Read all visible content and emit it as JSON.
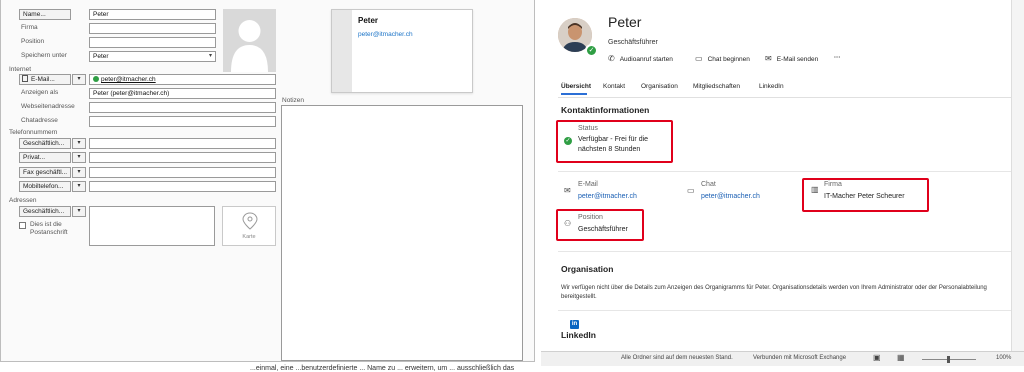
{
  "form": {
    "name_btn": "Name...",
    "name_val": "Peter",
    "firma_lbl": "Firma",
    "position_lbl": "Position",
    "speichern_lbl": "Speichern unter",
    "speichern_val": "Peter",
    "internet_lbl": "Internet",
    "email_btn": "E-Mail...",
    "email_val": "peter@itmacher.ch",
    "anzeigen_lbl": "Anzeigen als",
    "anzeigen_val": "Peter (peter@itmacher.ch)",
    "webseite_lbl": "Webseitenadresse",
    "chat_lbl": "Chatadresse",
    "telefon_lbl": "Telefonnummern",
    "phones": [
      "Geschäftlich...",
      "Privat...",
      "Fax geschäftl...",
      "Mobiltelefon..."
    ],
    "adressen_lbl": "Adressen",
    "adr_btn": "Geschäftlich...",
    "postanschrift": "Dies ist die Postanschrift",
    "notizen_lbl": "Notizen",
    "karte": "Karte",
    "card_name": "Peter",
    "card_email": "peter@itmacher.ch"
  },
  "profile": {
    "name": "Peter",
    "title": "Geschäftsführer",
    "actions": [
      "Audioanruf starten",
      "Chat beginnen",
      "E-Mail senden",
      "···"
    ],
    "tabs": [
      "Übersicht",
      "Kontakt",
      "Organisation",
      "Mitgliedschaften",
      "LinkedIn"
    ],
    "kontakt_heading": "Kontaktinformationen",
    "status_label": "Status",
    "status_line1": "Verfügbar - Frei für die",
    "status_line2": "nächsten 8 Stunden",
    "email_label": "E-Mail",
    "email_value": "peter@itmacher.ch",
    "chat_label": "Chat",
    "chat_value": "peter@itmacher.ch",
    "firma_label": "Firma",
    "firma_value": "IT-Macher Peter Scheurer",
    "position_label": "Position",
    "position_value": "Geschäftsführer",
    "org_heading": "Organisation",
    "org_text": "Wir verfügen nicht über die Details zum Anzeigen des Organigramms für Peter. Organisationsdetails werden von Ihrem Administrator oder der Personalabteilung bereitgestellt.",
    "linkedin_heading": "LinkedIn",
    "linkedin_logo": "in"
  },
  "statusbar": {
    "sync": "Alle Ordner sind auf dem neuesten Stand.",
    "connection": "Verbunden mit Microsoft Exchange",
    "zoom": "100%"
  },
  "bottom_text": "...einmal, eine ...benutzerdefinierte ... Name zu ... erweitern, um ... ausschließlich das",
  "colors": {
    "accent": "#2b6fd6",
    "highlight": "#e0001b",
    "presence": "#2f9e44",
    "link": "#1a5fb4"
  }
}
